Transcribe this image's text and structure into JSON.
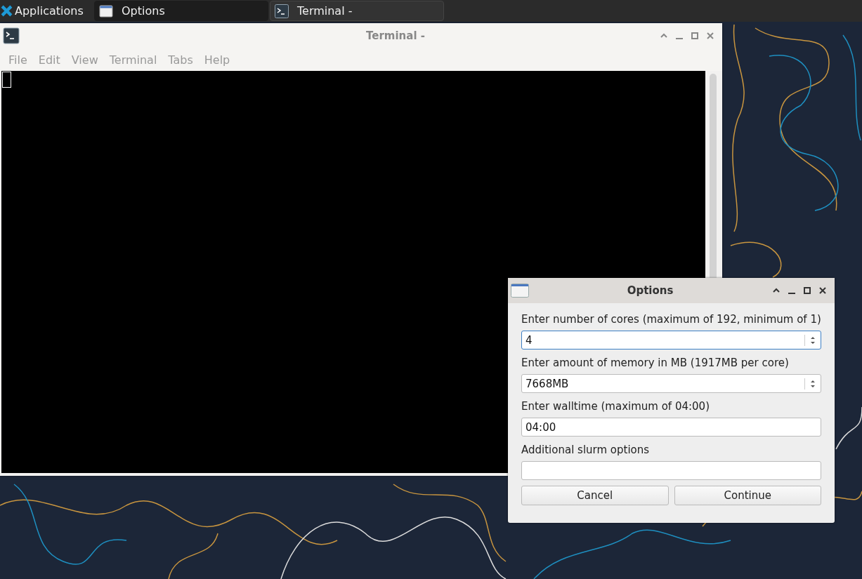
{
  "taskbar": {
    "menu_label": "Applications",
    "tasks": [
      {
        "label": "Options",
        "selected": false,
        "kind": "window"
      },
      {
        "label": "Terminal -",
        "selected": true,
        "kind": "terminal"
      }
    ]
  },
  "terminal_window": {
    "title": "Terminal -",
    "active": false,
    "menu": [
      "File",
      "Edit",
      "View",
      "Terminal",
      "Tabs",
      "Help"
    ]
  },
  "dialog": {
    "title": "Options",
    "active": true,
    "fields": [
      {
        "label": "Enter number of cores (maximum of 192, minimum of 1)",
        "kind": "spin",
        "value": "4",
        "focused": true
      },
      {
        "label": "Enter amount of memory in MB (1917MB per core)",
        "kind": "spin",
        "value": "7668MB",
        "focused": false
      },
      {
        "label": "Enter walltime (maximum of 04:00)",
        "kind": "text",
        "value": "04:00",
        "focused": false
      },
      {
        "label": "Additional slurm options",
        "kind": "text",
        "focused": false
      }
    ],
    "buttons": [
      "Cancel",
      "Continue"
    ]
  }
}
